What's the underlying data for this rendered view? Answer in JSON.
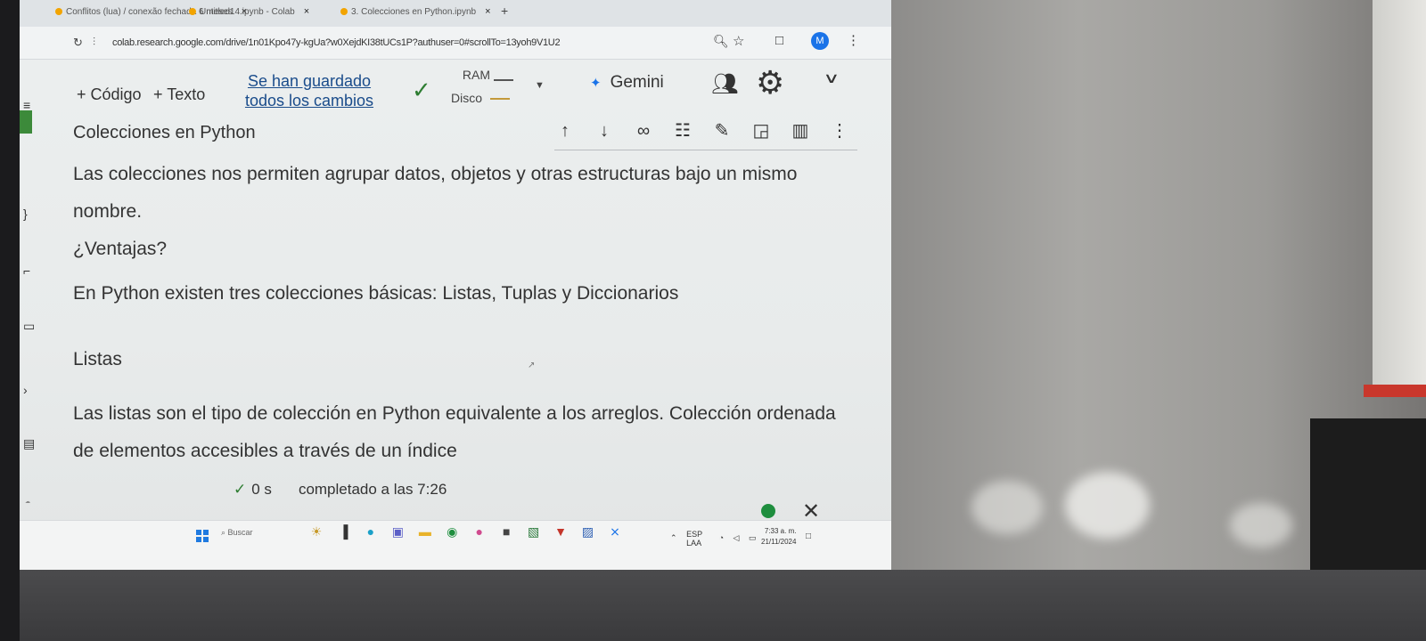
{
  "browser": {
    "tabs": [
      {
        "label": "Conflitos (lua) / conexão fechada 6 meses"
      },
      {
        "label": "Untitled14.ipynb - Colab"
      },
      {
        "label": "3. Colecciones en Python.ipynb"
      }
    ],
    "new_tab": "+",
    "close_glyph": "×",
    "url": "colab.research.google.com/drive/1n01Kpo47y-kgUa?w0XejdKI38tUCs1P?authuser=0#scrollTo=13yoh9V1U2",
    "profile_initial": "M"
  },
  "toolbar": {
    "add_code": "+ Código",
    "add_text": "+ Texto",
    "saved_line1": "Se han guardado",
    "saved_line2": "todos los cambios",
    "ram_label": "RAM",
    "disk_label": "Disco",
    "gemini_label": "Gemini"
  },
  "cell": {
    "title": "Colecciones en Python"
  },
  "content": {
    "intro": "Las colecciones nos permiten agrupar datos, objetos y otras estructuras bajo un mismo nombre.",
    "question": "¿Ventajas?",
    "basic": "En Python existen tres colecciones básicas: Listas, Tuplas y Diccionarios",
    "listas_heading": "Listas",
    "listas_desc": "Las listas son el tipo de colección en Python equivalente a los arreglos. Colección ordenada de elementos accesibles a través de un índice"
  },
  "status": {
    "duration": "0 s",
    "completed": "completado a las 7:26"
  },
  "taskbar": {
    "search_placeholder": "Buscar",
    "lang_line1": "ESP",
    "lang_line2": "LAA",
    "time": "7:33 a. m.",
    "date": "21/11/2024"
  },
  "colors": {
    "accent_blue": "#1a73e8",
    "success_green": "#1e8e3e"
  }
}
